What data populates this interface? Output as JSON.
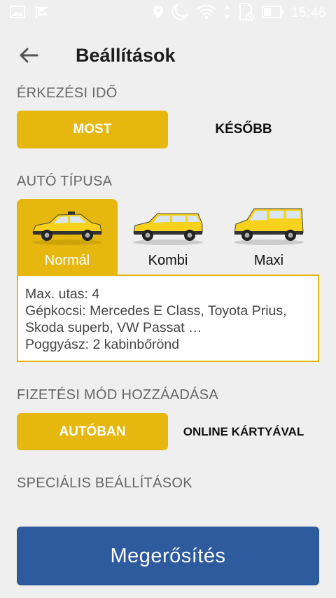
{
  "status_bar": {
    "time": "15:46",
    "icons": [
      "image-icon",
      "check-flag-icon",
      "location-icon",
      "moon-icon",
      "wifi-icon",
      "data-arrows-icon",
      "sim-off-icon",
      "battery-icon"
    ]
  },
  "header": {
    "back_icon": "arrow-left-icon",
    "title": "Beállítások"
  },
  "arrival": {
    "label": "ÉRKEZÉSI IDŐ",
    "now_label": "MOST",
    "later_label": "KÉSŐBB"
  },
  "car_type": {
    "label": "AUTÓ TÍPUSA",
    "options": [
      {
        "label": "Normál",
        "selected": true
      },
      {
        "label": "Kombi",
        "selected": false
      },
      {
        "label": "Maxi",
        "selected": false
      }
    ],
    "info": {
      "line1": "Max. utas: 4",
      "line2": "Gépkocsi: Mercedes E Class, Toyota Prius,",
      "line3": "Skoda superb, VW Passat …",
      "line4": "Poggyász: 2 kabinbőrönd"
    }
  },
  "payment": {
    "label": "FIZETÉSI MÓD HOZZÁADÁSA",
    "car_label": "AUTÓBAN",
    "online_label": "ONLINE KÁRTYÁVAL"
  },
  "special": {
    "label": "SPECIÁLIS BEÁLLÍTÁSOK"
  },
  "confirm": {
    "label": "Megerősítés"
  },
  "colors": {
    "accent": "#e6b80f",
    "primary": "#2e5a9e",
    "background": "#efefef"
  }
}
